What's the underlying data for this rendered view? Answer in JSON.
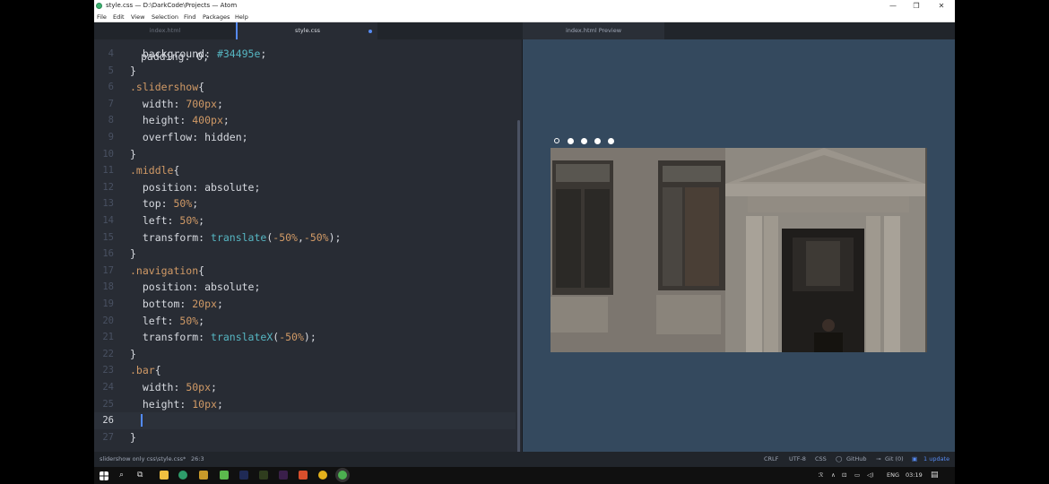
{
  "window": {
    "title": "style.css — D:\\DarkCode\\Projects — Atom",
    "minimize_glyph": "—",
    "maximize_glyph": "❐",
    "close_glyph": "✕"
  },
  "menu": [
    "File",
    "Edit",
    "View",
    "Selection",
    "Find",
    "Packages",
    "Help"
  ],
  "tabs": [
    {
      "label": "index.html",
      "active": false
    },
    {
      "label": "style.css",
      "active": true,
      "modified": true
    },
    {
      "label": "index.html Preview",
      "active": false
    }
  ],
  "editor": {
    "partial_top": "padding: 0;",
    "lines": [
      {
        "n": "4",
        "text": "  background: #34495e;"
      },
      {
        "n": "5",
        "text": "}"
      },
      {
        "n": "6",
        "text": ".slidershow{"
      },
      {
        "n": "7",
        "text": "  width: 700px;"
      },
      {
        "n": "8",
        "text": "  height: 400px;"
      },
      {
        "n": "9",
        "text": "  overflow: hidden;"
      },
      {
        "n": "10",
        "text": "}"
      },
      {
        "n": "11",
        "text": ".middle{"
      },
      {
        "n": "12",
        "text": "  position: absolute;"
      },
      {
        "n": "13",
        "text": "  top: 50%;"
      },
      {
        "n": "14",
        "text": "  left: 50%;"
      },
      {
        "n": "15",
        "text": "  transform: translate(-50%,-50%);"
      },
      {
        "n": "16",
        "text": "}"
      },
      {
        "n": "17",
        "text": ".navigation{"
      },
      {
        "n": "18",
        "text": "  position: absolute;"
      },
      {
        "n": "19",
        "text": "  bottom: 20px;"
      },
      {
        "n": "20",
        "text": "  left: 50%;"
      },
      {
        "n": "21",
        "text": "  transform: translateX(-50%);"
      },
      {
        "n": "22",
        "text": "}"
      },
      {
        "n": "23",
        "text": ".bar{"
      },
      {
        "n": "24",
        "text": "  width: 50px;"
      },
      {
        "n": "25",
        "text": "  height: 10px;"
      },
      {
        "n": "26",
        "text": "  "
      },
      {
        "n": "27",
        "text": "}"
      }
    ],
    "cursor_line": "26"
  },
  "preview": {
    "background": "#34495e",
    "nav_dots": 5,
    "active_dot": 1,
    "image_subject": "stone building entrance with a person standing in doorway"
  },
  "status": {
    "file": "slidershow only css\\style.css*",
    "position": "26:3",
    "line_ending": "CRLF",
    "encoding": "UTF-8",
    "grammar": "CSS",
    "github": "GitHub",
    "git": "Git (0)",
    "update": "1 update"
  },
  "taskbar": {
    "lang": "ENG",
    "time": "03:19"
  }
}
